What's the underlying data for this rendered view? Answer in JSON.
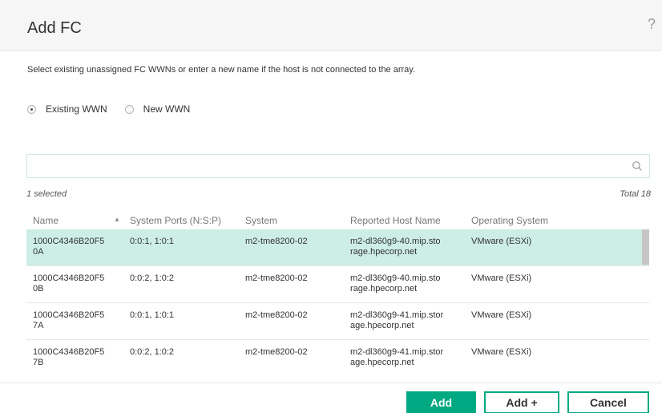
{
  "dialog": {
    "title": "Add FC",
    "help": "?",
    "instruction": "Select existing unassigned FC WWNs or enter a new name if the host is not connected to the array."
  },
  "radios": [
    {
      "label": "Existing WWN",
      "checked": true
    },
    {
      "label": "New WWN",
      "checked": false
    }
  ],
  "search": {
    "value": "",
    "placeholder": ""
  },
  "summary": {
    "selected": "1 selected",
    "total": "Total 18"
  },
  "table": {
    "columns": [
      "Name",
      "System Ports (N:S:P)",
      "System",
      "Reported Host Name",
      "Operating System"
    ],
    "sort": {
      "column": "Name",
      "direction": "ascending"
    },
    "rows": [
      {
        "name": [
          "1000C4346B20F5",
          "0A"
        ],
        "ports": "0:0:1, 1:0:1",
        "system": "m2-tme8200-02",
        "host": [
          "m2-dl360g9-40.mip.sto",
          "rage.hpecorp.net"
        ],
        "os": "VMware (ESXi)",
        "selected": true
      },
      {
        "name": [
          "1000C4346B20F5",
          "0B"
        ],
        "ports": "0:0:2, 1:0:2",
        "system": "m2-tme8200-02",
        "host": [
          "m2-dl360g9-40.mip.sto",
          "rage.hpecorp.net"
        ],
        "os": "VMware (ESXi)",
        "selected": false
      },
      {
        "name": [
          "1000C4346B20F5",
          "7A"
        ],
        "ports": "0:0:1, 1:0:1",
        "system": "m2-tme8200-02",
        "host": [
          "m2-dl360g9-41.mip.stor",
          "age.hpecorp.net"
        ],
        "os": "VMware (ESXi)",
        "selected": false
      },
      {
        "name": [
          "1000C4346B20F5",
          "7B"
        ],
        "ports": "0:0:2, 1:0:2",
        "system": "m2-tme8200-02",
        "host": [
          "m2-dl360g9-41.mip.stor",
          "age.hpecorp.net"
        ],
        "os": "VMware (ESXi)",
        "selected": false
      }
    ]
  },
  "buttons": {
    "add": "Add",
    "add_plus": "Add +",
    "cancel": "Cancel"
  },
  "colors": {
    "accent": "#01a982",
    "selected_row": "#cdeee6",
    "header_bg": "#f6f6f6"
  },
  "icons": {
    "search": "search-icon",
    "sort": "sort-ascending-icon",
    "help": "help-icon"
  }
}
